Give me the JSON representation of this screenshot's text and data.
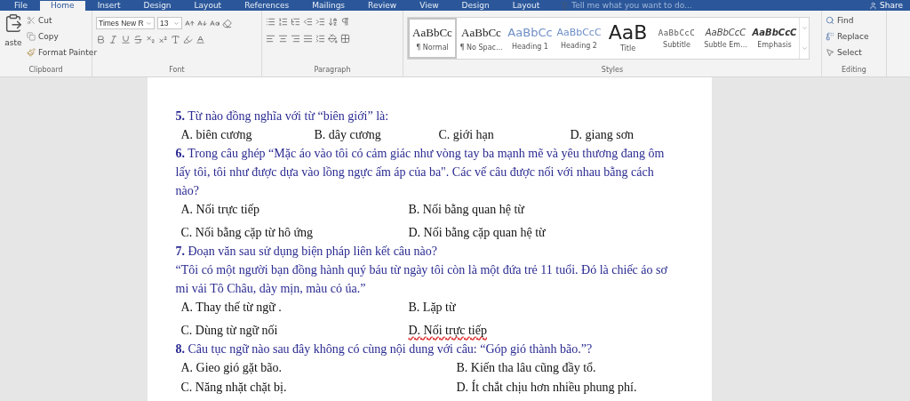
{
  "tabs": [
    {
      "label": "File",
      "selected": false
    },
    {
      "label": "Home",
      "selected": true
    },
    {
      "label": "Insert",
      "selected": false
    },
    {
      "label": "Design",
      "selected": false
    },
    {
      "label": "Layout",
      "selected": false
    },
    {
      "label": "References",
      "selected": false
    },
    {
      "label": "Mailings",
      "selected": false
    },
    {
      "label": "Review",
      "selected": false
    },
    {
      "label": "View",
      "selected": false
    },
    {
      "label": "Design",
      "selected": false
    },
    {
      "label": "Layout",
      "selected": false
    }
  ],
  "tell_me": {
    "placeholder": "Tell me what you want to do..."
  },
  "share": "Share",
  "clipboard": {
    "paste": "aste",
    "cut": "Cut",
    "copy": "Copy",
    "format_painter": "Format Painter",
    "label": "Clipboard"
  },
  "font": {
    "name": "Times New R",
    "size": "13",
    "label": "Font"
  },
  "paragraph": {
    "label": "Paragraph"
  },
  "styles": {
    "label": "Styles",
    "items": [
      {
        "kind": "normal",
        "preview": "AaBbCc",
        "name": "¶ Normal",
        "selected": true
      },
      {
        "kind": "no_spacing",
        "preview": "AaBbCc",
        "name": "¶ No Spac...",
        "selected": false
      },
      {
        "kind": "heading1",
        "preview": "AaBbCc",
        "name": "Heading 1",
        "selected": false
      },
      {
        "kind": "heading2",
        "preview": "AaBbCcC",
        "name": "Heading 2",
        "selected": false
      },
      {
        "kind": "title",
        "preview": "AaB",
        "name": "Title",
        "selected": false
      },
      {
        "kind": "subtitle",
        "preview": "AaBbCcC",
        "name": "Subtitle",
        "selected": false
      },
      {
        "kind": "subtle_emphasis",
        "preview": "AaBbCcC",
        "name": "Subtle Em...",
        "selected": false
      },
      {
        "kind": "emphasis",
        "preview": "AaBbCcC",
        "name": "Emphasis",
        "selected": false
      }
    ]
  },
  "editing": {
    "find": "Find",
    "replace": "Replace",
    "select": "Select",
    "label": "Editing"
  },
  "questions": [
    {
      "number": "5.",
      "text": "Từ nào đồng nghĩa với từ “biên giới” là:",
      "kind": "row",
      "options": [
        {
          "text": "A. biên cương",
          "spelling_error": false
        },
        {
          "text": "B. dây cương",
          "spelling_error": false
        },
        {
          "text": "C. giới hạn",
          "spelling_error": false
        },
        {
          "text": "D. giang sơn",
          "spelling_error": false
        }
      ]
    },
    {
      "number": "6.",
      "text": "Trong câu ghép  “Mặc áo vào tôi có cảm giác như vòng tay ba mạnh mẽ và yêu thương đang ôm lấy tôi, tôi như được dựa vào lồng ngực ấm áp của ba\". Các vế câu được nối với nhau bằng cách  nào?",
      "kind": "pairs",
      "options": [
        {
          "text": "A. Nối trực tiếp",
          "spelling_error": false
        },
        {
          "text": "B. Nối bằng quan hệ từ",
          "spelling_error": false
        },
        {
          "text": "C. Nối bằng cặp từ hô ứng",
          "spelling_error": false
        },
        {
          "text": "D. Nối bằng cặp quan hệ từ",
          "spelling_error": false
        }
      ]
    },
    {
      "number": "7.",
      "text": "Đoạn văn sau sử dụng biện pháp  liên kết câu nào?",
      "passage": "“Tôi có một người bạn đồng hành quý báu từ ngày tôi còn là một đứa trẻ 11 tuổi. Đó là chiếc áo sơ mi vải Tô Châu, dày mịn, màu cỏ úa.”",
      "kind": "pairs",
      "options": [
        {
          "text": "A. Thay thế từ ngữ    .",
          "spelling_error": false
        },
        {
          "text": "B. Lặp từ",
          "spelling_error": false
        },
        {
          "text": "C. Dùng từ ngữ nối",
          "spelling_error": false
        },
        {
          "text": "D. Nối trực tiếp",
          "spelling_error": true
        }
      ]
    },
    {
      "number": "8.",
      "text": "Câu tục ngữ nào sau đây không có cùng nội dung với câu: “Góp gió thành bão.”?",
      "kind": "wide_pairs",
      "options": [
        {
          "text": "A. Gieo gió gặt bão.",
          "spelling_error": false
        },
        {
          "text": "B. Kiến tha lâu cũng đầy tổ.",
          "spelling_error": false
        },
        {
          "text": "C. Năng nhặt chặt bị.",
          "spelling_error": false
        },
        {
          "text": "D. Ít chắt chịu hơn nhiều phung phí.",
          "spelling_error": false
        }
      ]
    }
  ]
}
